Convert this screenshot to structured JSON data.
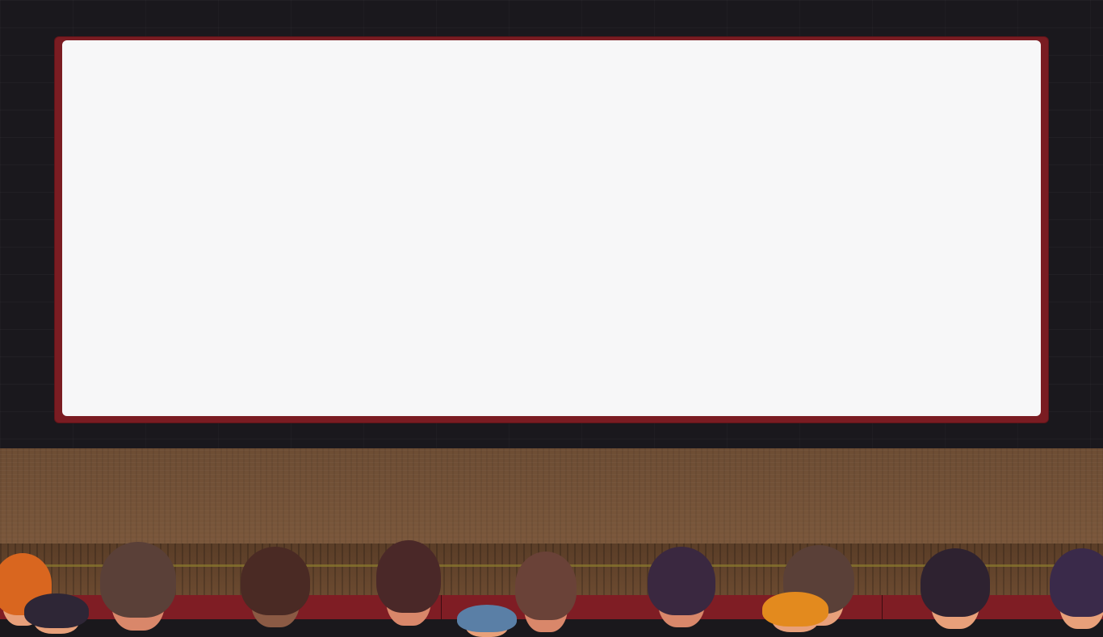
{
  "scene": {
    "colors": {
      "wall": "#1a181d",
      "screen_frame": "#7a1c22",
      "screen": "#f7f7f8",
      "stage_wood": "#6d4d34",
      "seats": "#7f1d24"
    },
    "audience": [
      {
        "hair": "#d9661f",
        "skin": "#e8a07a"
      },
      {
        "hair": "#2e2636",
        "skin": "#e8a07a"
      },
      {
        "hair": "#5a4038",
        "skin": "#d9876a"
      },
      {
        "hair": "#4a2a24",
        "skin": "#8b5a44"
      },
      {
        "hair": "#4a2828",
        "skin": "#d9876a"
      },
      {
        "hair": "#5a7fa6",
        "skin": "#e8a07a"
      },
      {
        "hair": "#6a4238",
        "skin": "#d9876a"
      },
      {
        "hair": "#3a2840",
        "skin": "#d9876a"
      },
      {
        "hair": "#5a4038",
        "skin": "#e8a07a"
      },
      {
        "hair": "#e38a1e",
        "skin": "#e8a07a"
      },
      {
        "hair": "#2e2230",
        "skin": "#e8a07a"
      },
      {
        "hair": "#3a2a4a",
        "skin": "#e8a07a"
      }
    ]
  }
}
